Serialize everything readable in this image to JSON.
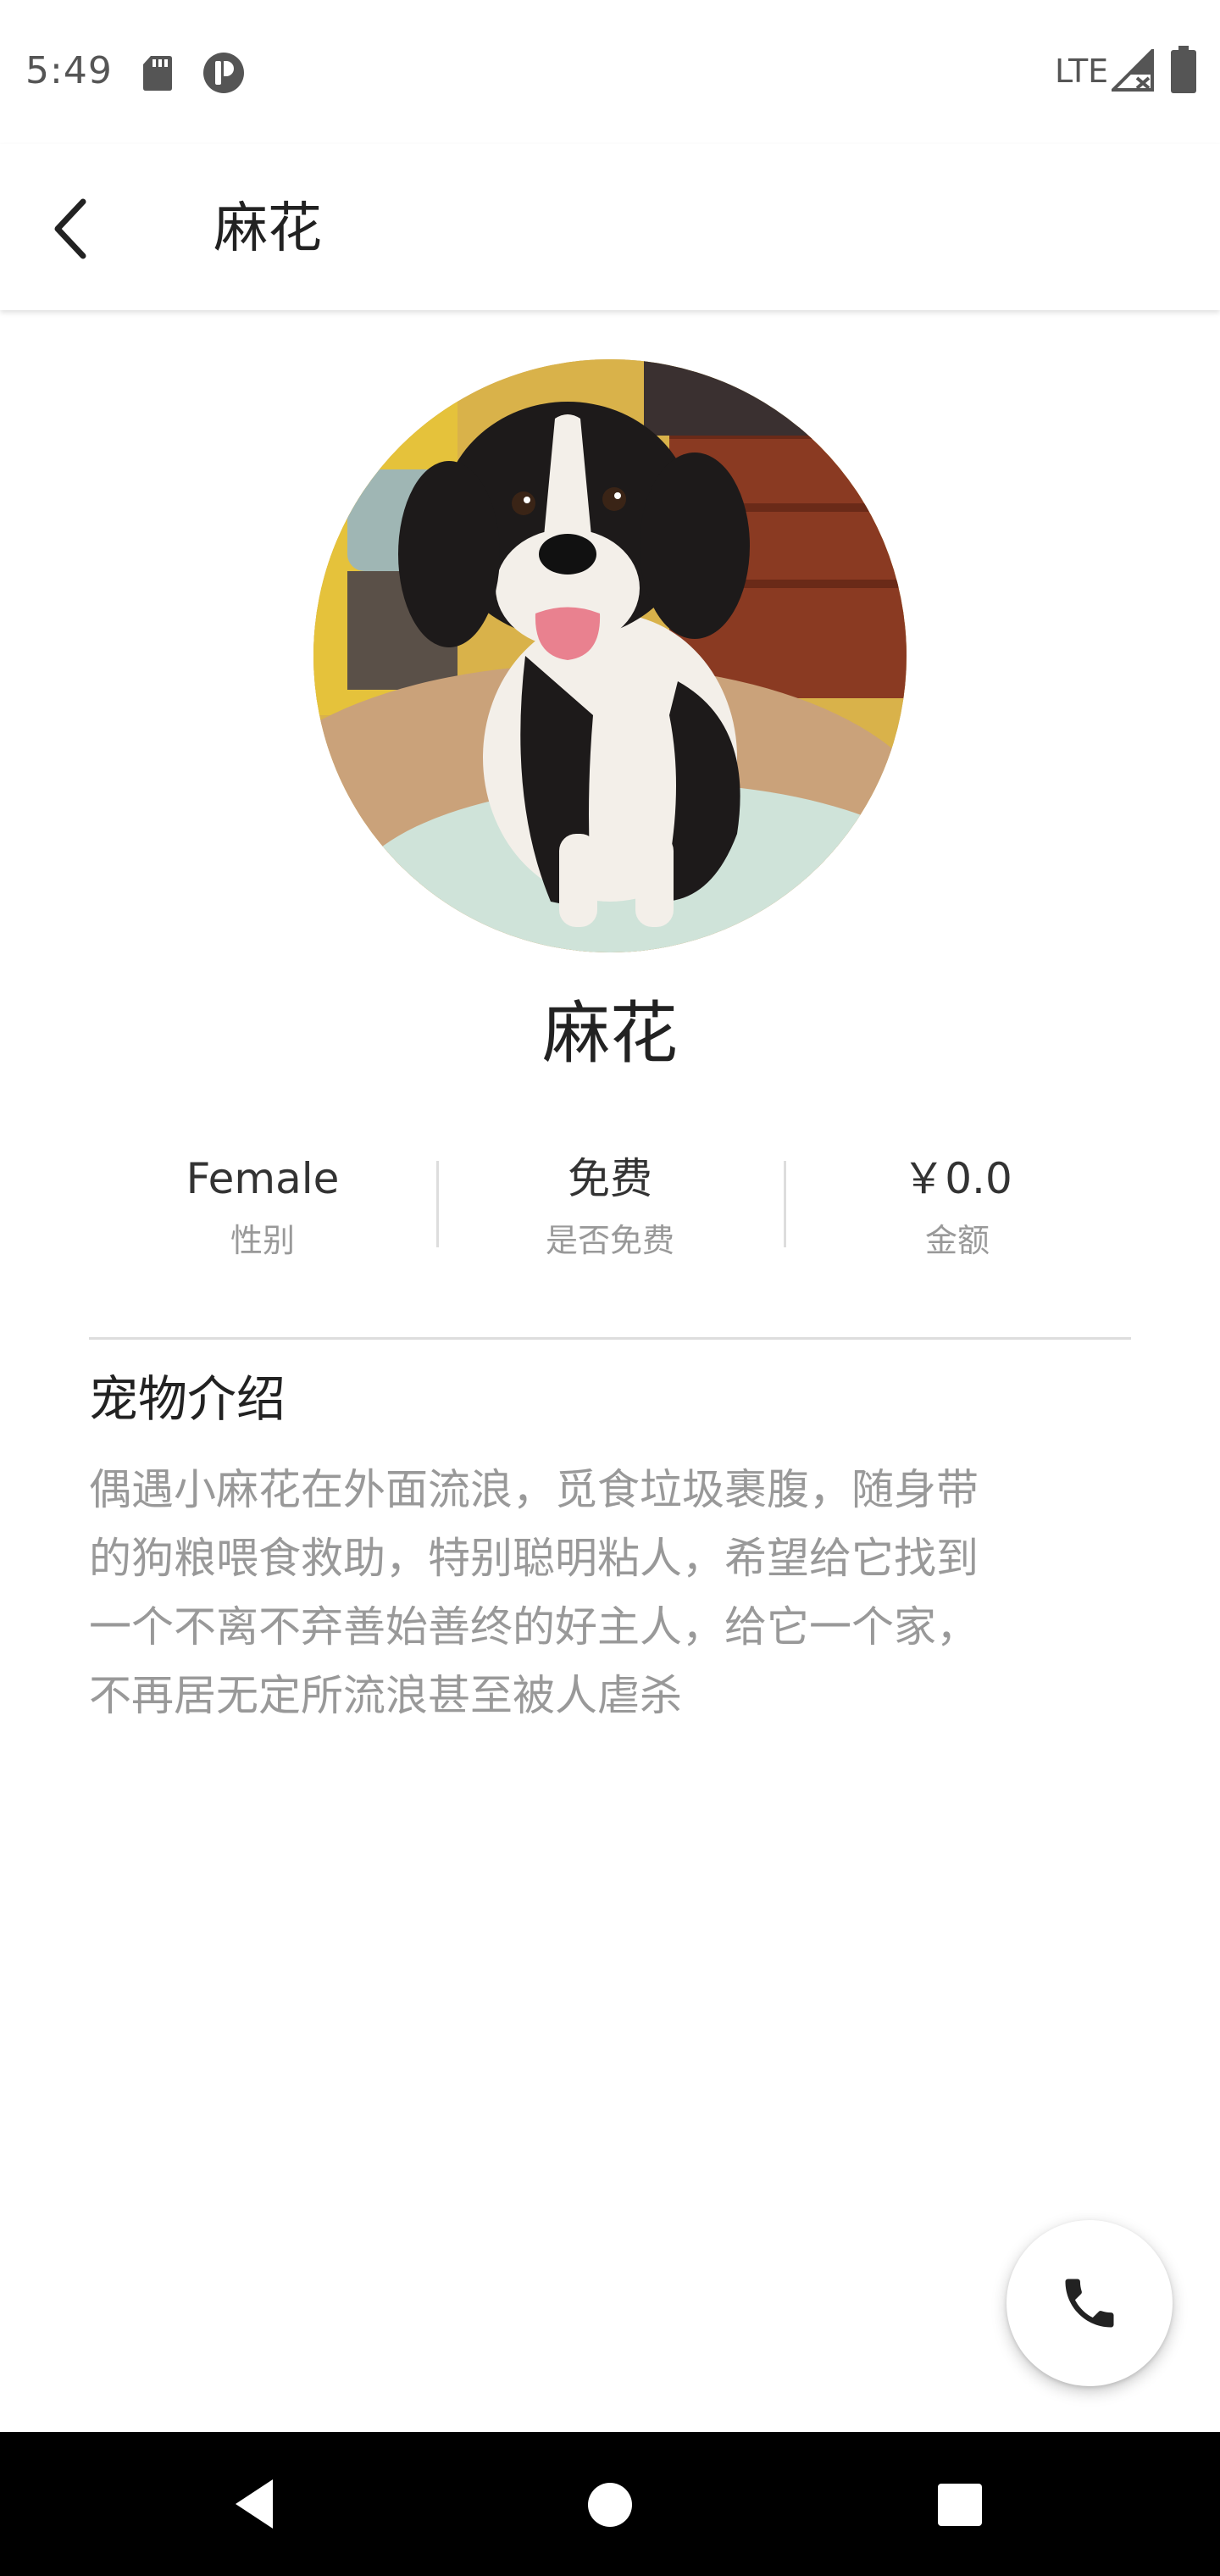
{
  "status_bar": {
    "time": "5:49",
    "network": "LTE",
    "icons": [
      "sd-card-icon",
      "p-app-icon",
      "signal-icon",
      "battery-icon"
    ]
  },
  "app_bar": {
    "title": "麻花",
    "back_icon": "chevron-left-icon"
  },
  "pet": {
    "name": "麻花",
    "photo_description_icon": "dog-photo",
    "stats": [
      {
        "value": "Female",
        "label": "性别"
      },
      {
        "value": "免费",
        "label": "是否免费"
      },
      {
        "value": "￥0.0",
        "label": "金额"
      }
    ]
  },
  "intro": {
    "title": "宠物介绍",
    "lines": [
      "偶遇小麻花在外面流浪，觅食垃圾裹腹，随身带",
      "的狗粮喂食救助，特别聪明粘人，希望给它找到",
      "一个不离不弃善始善终的好主人，给它一个家，",
      "不再居无定所流浪甚至被人虐杀"
    ]
  },
  "fab": {
    "icon": "phone-icon"
  },
  "nav_bar": {
    "icons": [
      "nav-back-icon",
      "nav-home-icon",
      "nav-recent-icon"
    ]
  },
  "colors": {
    "primary_text": "#222222",
    "secondary_text": "#999999",
    "divider": "#dddddd",
    "nav_bar": "#000000"
  }
}
